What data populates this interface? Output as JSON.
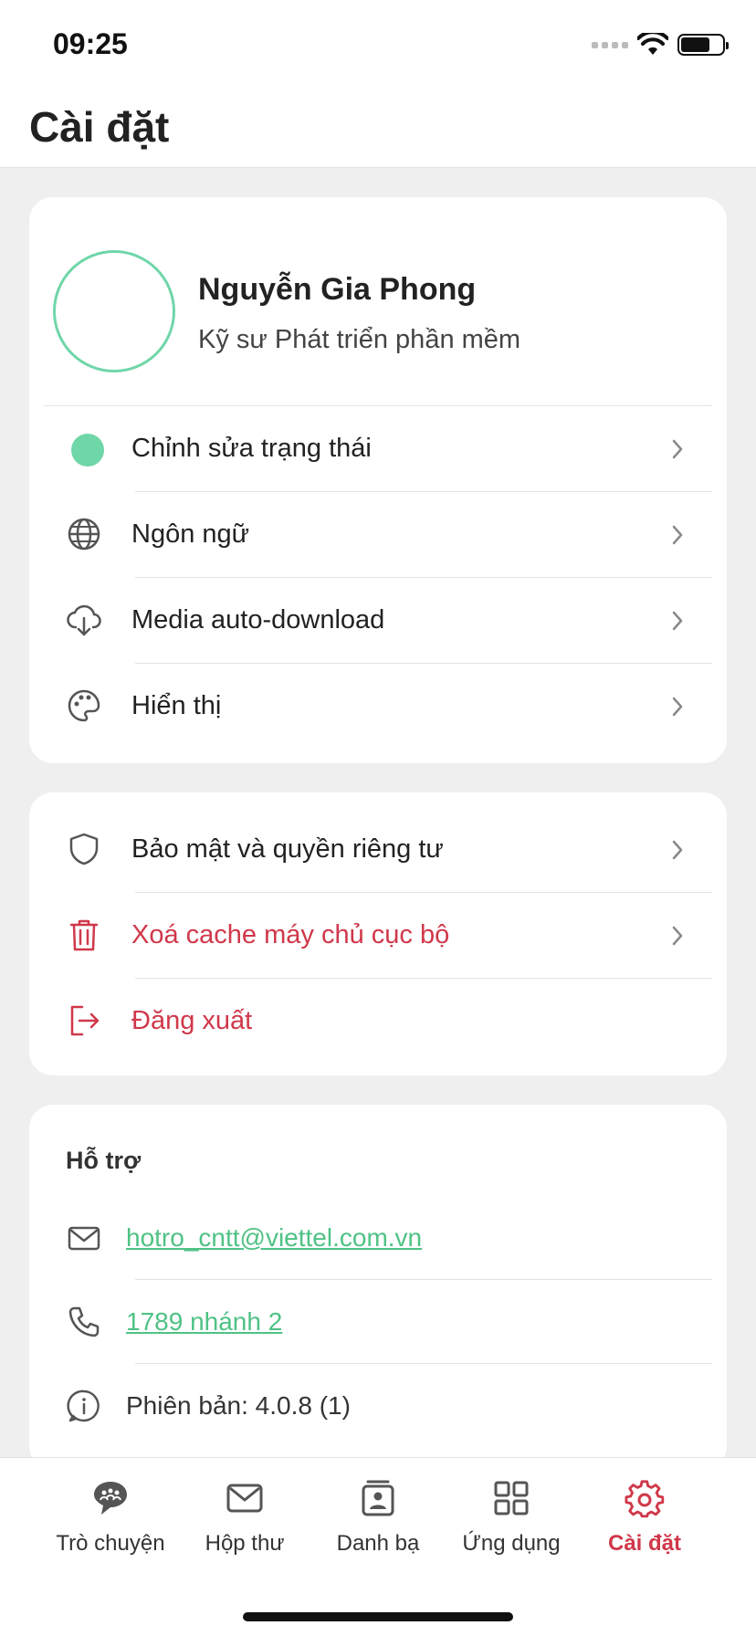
{
  "status_bar": {
    "time": "09:25"
  },
  "header": {
    "title": "Cài đặt"
  },
  "profile": {
    "name": "Nguyễn Gia Phong",
    "role": "Kỹ sư Phát triển phần mềm"
  },
  "settings_items": [
    {
      "label": "Chỉnh sửa trạng thái",
      "icon": "status-dot"
    },
    {
      "label": "Ngôn ngữ",
      "icon": "globe-icon"
    },
    {
      "label": "Media auto-download",
      "icon": "cloud-download-icon"
    },
    {
      "label": "Hiển thị",
      "icon": "palette-icon"
    }
  ],
  "account_items": [
    {
      "label": "Bảo mật và quyền riêng tư",
      "icon": "shield-icon"
    },
    {
      "label": "Xoá cache máy chủ cục bộ",
      "icon": "trash-icon"
    },
    {
      "label": "Đăng xuất",
      "icon": "logout-icon"
    }
  ],
  "support": {
    "title": "Hỗ trợ",
    "email": "hotro_cntt@viettel.com.vn",
    "phone": "1789 nhánh 2",
    "version": "Phiên bản: 4.0.8 (1)"
  },
  "tabs": [
    {
      "label": "Trò chuyện",
      "icon": "chat-icon"
    },
    {
      "label": "Hộp thư",
      "icon": "mail-icon"
    },
    {
      "label": "Danh bạ",
      "icon": "contacts-icon"
    },
    {
      "label": "Ứng dụng",
      "icon": "apps-grid-icon"
    },
    {
      "label": "Cài đặt",
      "icon": "gear-icon"
    }
  ],
  "colors": {
    "accent_green": "#6fd6a8",
    "danger_red": "#d0384a",
    "link_green": "#4fc285"
  }
}
